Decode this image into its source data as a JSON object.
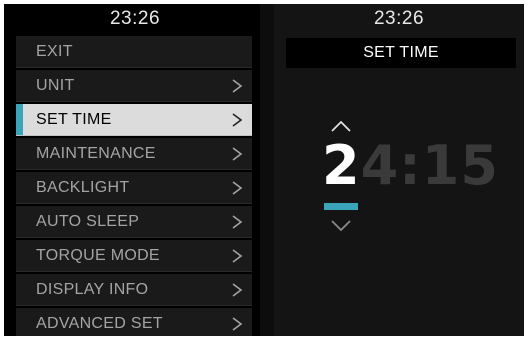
{
  "left_panel": {
    "clock": "23:26",
    "menu_items": [
      {
        "label": "EXIT",
        "has_arrow": false,
        "selected": false
      },
      {
        "label": "UNIT",
        "has_arrow": true,
        "selected": false
      },
      {
        "label": "SET TIME",
        "has_arrow": true,
        "selected": true
      },
      {
        "label": "MAINTENANCE",
        "has_arrow": true,
        "selected": false
      },
      {
        "label": "BACKLIGHT",
        "has_arrow": true,
        "selected": false
      },
      {
        "label": "AUTO SLEEP",
        "has_arrow": true,
        "selected": false
      },
      {
        "label": "TORQUE MODE",
        "has_arrow": true,
        "selected": false
      },
      {
        "label": "DISPLAY INFO",
        "has_arrow": true,
        "selected": false
      },
      {
        "label": "ADVANCED SET",
        "has_arrow": true,
        "selected": false
      }
    ]
  },
  "right_panel": {
    "clock": "23:26",
    "title": "SET TIME",
    "time_editor": {
      "active_digit": "2",
      "remaining_digits": "4:15",
      "up_icon": "chevron-up-icon",
      "down_icon": "chevron-down-icon"
    }
  },
  "colors": {
    "accent": "#3aa5b8",
    "selected_bg": "#dcdcdc",
    "item_bg": "#1a1a1a",
    "item_text": "#a4a4a4",
    "inactive_digits": "#3a3a3a"
  }
}
